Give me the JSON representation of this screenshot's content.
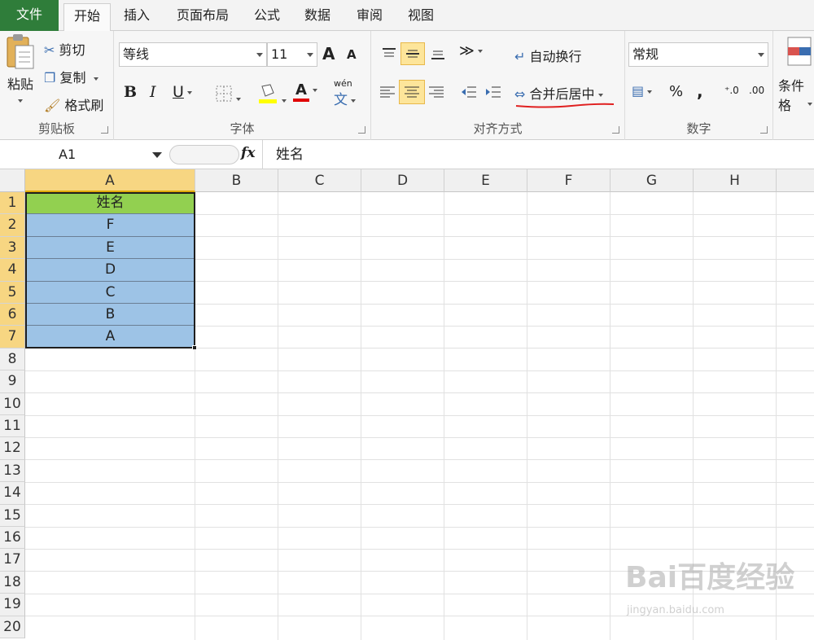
{
  "tabs": [
    {
      "id": "file",
      "label": "文件"
    },
    {
      "id": "home",
      "label": "开始"
    },
    {
      "id": "insert",
      "label": "插入"
    },
    {
      "id": "layout",
      "label": "页面布局"
    },
    {
      "id": "formulas",
      "label": "公式"
    },
    {
      "id": "data",
      "label": "数据"
    },
    {
      "id": "review",
      "label": "审阅"
    },
    {
      "id": "view",
      "label": "视图"
    }
  ],
  "clipboard": {
    "paste": "粘贴",
    "cut": "剪切",
    "copy": "复制",
    "format_painter": "格式刷",
    "label": "剪贴板"
  },
  "font": {
    "name": "等线",
    "size": "11",
    "bold": "B",
    "italic": "I",
    "underline": "U",
    "grow": "A",
    "shrink": "A",
    "font_color": "A",
    "phonetic": "wén",
    "label": "字体"
  },
  "alignment": {
    "wrap_text": "自动换行",
    "merge_center": "合并后居中",
    "label": "对齐方式"
  },
  "number": {
    "format": "常规",
    "percent": "%",
    "comma": ",",
    "label": "数字"
  },
  "styles": {
    "conditional": "条件格"
  },
  "formula_bar": {
    "name_box": "A1",
    "fx": "fx",
    "content": "姓名"
  },
  "columns": [
    "A",
    "B",
    "C",
    "D",
    "E",
    "F",
    "G",
    "H"
  ],
  "rows": [
    "1",
    "2",
    "3",
    "4",
    "5",
    "6",
    "7",
    "8",
    "9",
    "10",
    "11",
    "12",
    "13",
    "14",
    "15",
    "16",
    "17",
    "18",
    "19",
    "20"
  ],
  "cells": {
    "A1": "姓名",
    "A2": "F",
    "A3": "E",
    "A4": "D",
    "A5": "C",
    "A6": "B",
    "A7": "A"
  },
  "colors": {
    "header_fill": "#92d050",
    "body_fill": "#9dc3e6",
    "file_tab": "#2f7d3a",
    "annotation": "#e02020"
  },
  "watermark": {
    "brand": "Bai百度经验",
    "url": "jingyan.baidu.com"
  }
}
